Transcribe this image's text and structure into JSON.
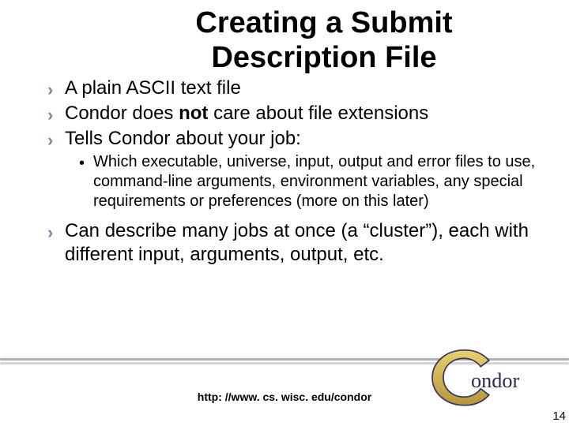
{
  "title": "Creating a Submit Description File",
  "bullets": {
    "b1": "A plain ASCII text file",
    "b2_pre": "Condor does ",
    "b2_bold": "not",
    "b2_post": " care about file extensions",
    "b3": "Tells Condor about your job:",
    "b3_sub": "Which executable, universe, input, output and error files to use, command-line arguments, environment variables, any special requirements or preferences (more on this later)",
    "b4": "Can describe many jobs at once (a “cluster”), each with different input, arguments, output, etc."
  },
  "footer": {
    "url": "http: //www. cs. wisc. edu/condor",
    "page": "14"
  },
  "logo": {
    "text": "ondor"
  }
}
